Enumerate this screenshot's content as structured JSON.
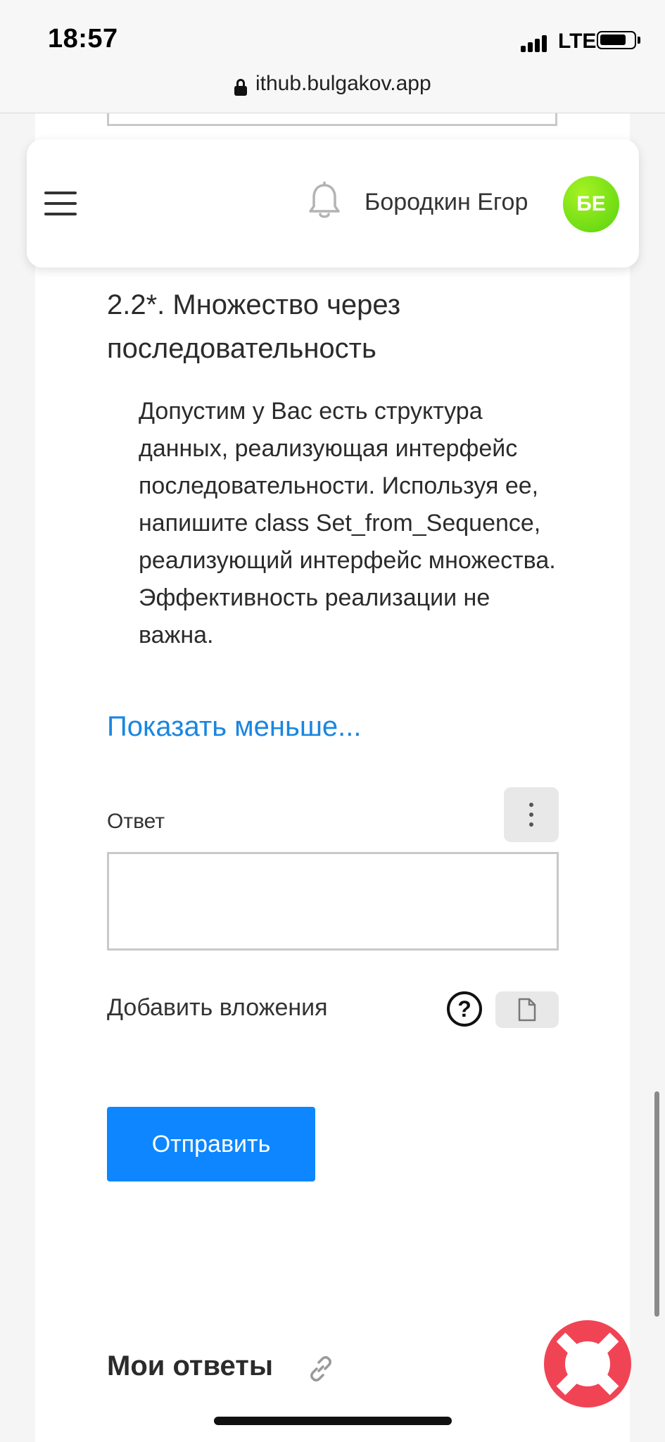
{
  "status_bar": {
    "time": "18:57",
    "network": "LTE"
  },
  "browser": {
    "url": "ithub.bulgakov.app"
  },
  "header": {
    "user_name": "Бородкин Егор",
    "avatar_initials": "БЕ"
  },
  "task": {
    "title": "2.2*. Множество через последовательность",
    "description": "Допустим у Вас есть структура данных, реализующая интерфейс последовательности. Используя ее, напишите class Set_from_Sequence, реализующий интерфейс множества. Эффективность реализации не важна.",
    "show_less": "Показать меньше..."
  },
  "answer": {
    "label": "Ответ",
    "value": "",
    "attach_label": "Добавить вложения",
    "help_glyph": "?",
    "submit_label": "Отправить"
  },
  "my_answers": {
    "title": "Мои ответы"
  },
  "icons": {
    "menu": "menu-icon",
    "bell": "bell-icon",
    "lock": "lock-icon",
    "more": "more-vertical-icon",
    "help": "help-icon",
    "file": "file-icon",
    "link": "link-icon",
    "support": "lifebuoy-icon"
  },
  "colors": {
    "accent": "#0d86ff",
    "link": "#1a86e0",
    "avatar": "#58d30f",
    "support": "#f04455"
  }
}
